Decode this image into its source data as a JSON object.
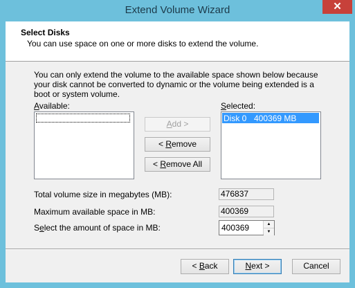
{
  "window": {
    "title": "Extend Volume Wizard",
    "close_glyph": "✕"
  },
  "header": {
    "title": "Select Disks",
    "subtitle": "You can use space on one or more disks to extend the volume."
  },
  "description": "You can only extend the volume to the available space shown below because your disk cannot be converted to dynamic or the volume being extended is a boot or system volume.",
  "available": {
    "label_hot": "A",
    "label_rest": "vailable:",
    "items": []
  },
  "selected": {
    "label_hot": "S",
    "label_rest": "elected:",
    "items": [
      {
        "disk": "Disk 0",
        "size": "400369 MB"
      }
    ]
  },
  "buttons": {
    "add_hot": "A",
    "add_rest": "dd >",
    "remove_pre": "< ",
    "remove_hot": "R",
    "remove_rest": "emove",
    "remove_all_pre": "< ",
    "remove_all_hot": "R",
    "remove_all_rest": "emove All",
    "back_pre": "< ",
    "back_hot": "B",
    "back_rest": "ack",
    "next_hot": "N",
    "next_rest": "ext >",
    "cancel": "Cancel"
  },
  "fields": {
    "total_label": "Total volume size in megabytes (MB):",
    "total_value": "476837",
    "max_label": "Maximum available space in MB:",
    "max_value": "400369",
    "amount_label_pre": "S",
    "amount_label_hot": "e",
    "amount_label_rest": "lect the amount of space in MB:",
    "amount_value": "400369"
  },
  "colors": {
    "titlebar": "#6dc0dc",
    "close": "#c7413a",
    "selection": "#3399ff"
  }
}
